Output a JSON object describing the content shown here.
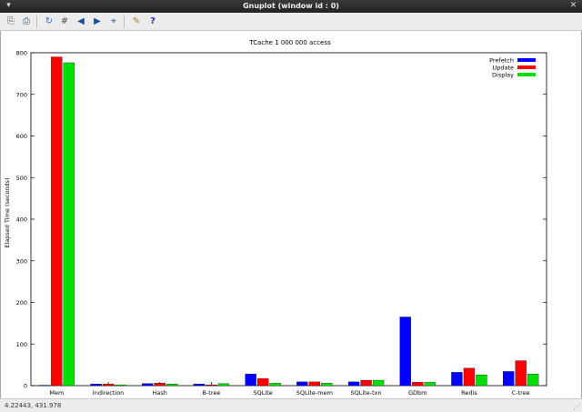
{
  "window": {
    "title": "Gnuplot (window id : 0)",
    "menu_glyph": "▾",
    "close_glyph": "✕"
  },
  "toolbar": {
    "buttons": [
      {
        "name": "copy-clipboard-icon",
        "glyph": "⎘"
      },
      {
        "name": "print-icon",
        "glyph": "⎙"
      },
      {
        "name": "replot-icon",
        "glyph": "↻"
      },
      {
        "name": "grid-icon",
        "glyph": "#"
      },
      {
        "name": "zoom-previous-icon",
        "glyph": "◀"
      },
      {
        "name": "zoom-next-icon",
        "glyph": "▶"
      },
      {
        "name": "autoscale-icon",
        "glyph": "⌖"
      },
      {
        "name": "options-icon",
        "glyph": "✎"
      },
      {
        "name": "help-icon",
        "glyph": "?"
      }
    ]
  },
  "status": {
    "coords": "4.22443,  431.978"
  },
  "colors": {
    "prefetch": "#0000ff",
    "update": "#ff0000",
    "display": "#00e000"
  },
  "chart_data": {
    "type": "bar",
    "title": "TCache 1 000 000 access",
    "xlabel": "",
    "ylabel": "Elapsed Time (seconds)",
    "ylim": [
      0,
      800
    ],
    "yticks": [
      0,
      100,
      200,
      300,
      400,
      500,
      600,
      700,
      800
    ],
    "grid": false,
    "legend_position": "top-right",
    "categories": [
      "Mem",
      "Indirection",
      "Hash",
      "B-tree",
      "SQLite",
      "SQLite-mem",
      "SQLite-txn",
      "GDbm",
      "Redis",
      "C-tree"
    ],
    "series": [
      {
        "name": "Prefetch",
        "color": "#0000ff",
        "values": [
          1,
          4,
          5,
          4,
          28,
          9,
          9,
          165,
          32,
          34
        ]
      },
      {
        "name": "Update",
        "color": "#ff0000",
        "values": [
          790,
          4,
          6,
          2,
          17,
          9,
          13,
          8,
          42,
          60
        ]
      },
      {
        "name": "Display",
        "color": "#00e000",
        "values": [
          776,
          2,
          4,
          5,
          6,
          6,
          13,
          8,
          26,
          28
        ]
      }
    ]
  }
}
